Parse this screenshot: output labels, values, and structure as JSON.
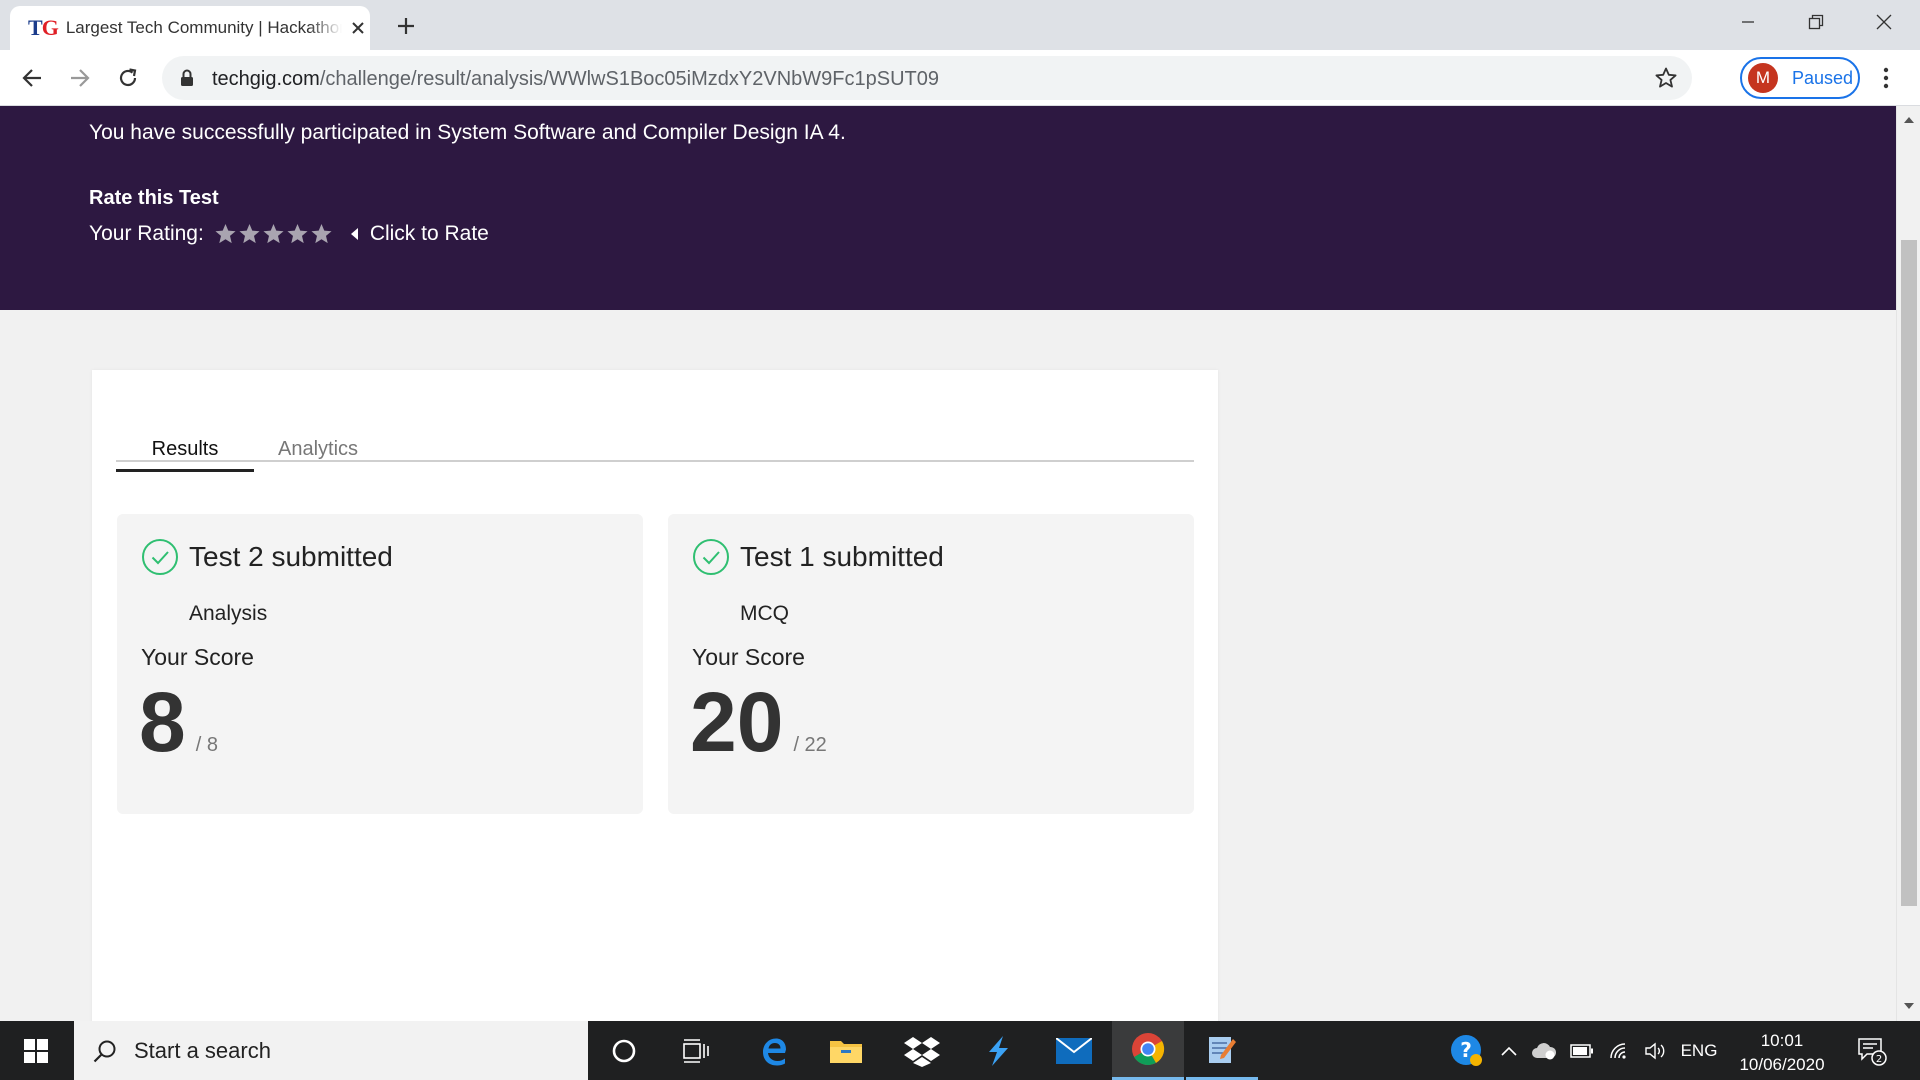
{
  "browser": {
    "tab_title": "Largest Tech Community | Hackathons",
    "tab_favicon_t": "T",
    "tab_favicon_g": "G",
    "url_domain": "techgig.com",
    "url_path": "/challenge/result/analysis/WWlwS1Boc05iMzdxY2VNbW9Fc1pSUT09",
    "profile_initial": "M",
    "profile_status": "Paused"
  },
  "banner": {
    "message": "You have successfully participated in System Software and Compiler Design IA 4.",
    "rate_title": "Rate this Test",
    "rating_label": "Your Rating:",
    "rating_value": 0,
    "rating_max": 5,
    "click_to_rate": "Click to Rate"
  },
  "tabs": {
    "results": "Results",
    "analytics": "Analytics"
  },
  "results": [
    {
      "title": "Test 2 submitted",
      "type": "Analysis",
      "score_label": "Your Score",
      "score": "8",
      "total": "/ 8"
    },
    {
      "title": "Test 1 submitted",
      "type": "MCQ",
      "score_label": "Your Score",
      "score": "20",
      "total": "/ 22"
    }
  ],
  "taskbar": {
    "search_placeholder": "Start a search",
    "language": "ENG",
    "time": "10:01",
    "date": "10/06/2020",
    "notification_count": "2"
  },
  "colors": {
    "banner_bg": "#2d1841",
    "check_green": "#2fbf71",
    "star_grey": "#a9a4b0",
    "chrome_blue": "#1a73e8"
  }
}
